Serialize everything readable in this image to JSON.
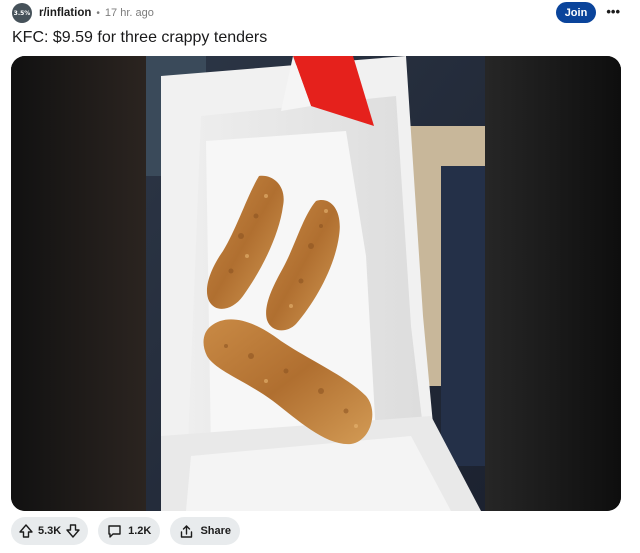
{
  "post": {
    "community": {
      "avatar_text": "3.5%",
      "name": "r/inflation",
      "separator": "•",
      "time_ago": "17 hr. ago"
    },
    "join_label": "Join",
    "more_label": "•••",
    "title": "KFC: $9.59 for three crappy tenders",
    "image": {
      "description_icon": "photo-of-chicken-tenders"
    },
    "actions": {
      "upvote_count": "5.3K",
      "comment_count": "1.2K",
      "share_label": "Share"
    }
  },
  "colors": {
    "join_button": "#0a449b",
    "action_pill": "#e8ebed",
    "kfc_red": "#e5211c"
  }
}
